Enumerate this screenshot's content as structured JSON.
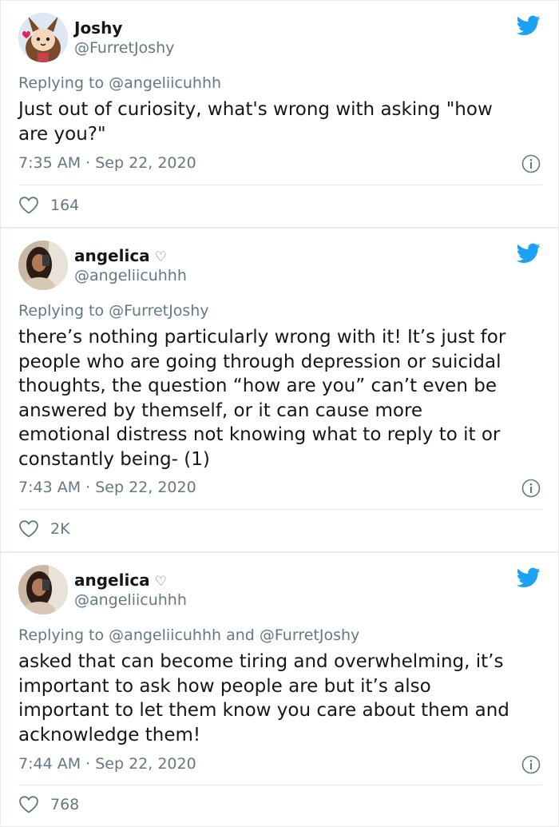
{
  "colors": {
    "brand_blue": "#1da1f2",
    "text": "#14171a",
    "secondary": "#657786",
    "border": "#e6ecf0"
  },
  "tweets": [
    {
      "name": "Joshy",
      "handle": "@FurretJoshy",
      "replying_prefix": "Replying to",
      "replying_to": [
        "@angeliicuhhh"
      ],
      "body_lines": [
        "Just out of curiosity, what's wrong with asking \"how",
        "are you?\""
      ],
      "timestamp": "7:35 AM · Sep 22, 2020",
      "likes": "164",
      "icons": {
        "brand": "twitter-bird-icon",
        "info": "info-icon",
        "like": "heart-icon"
      }
    },
    {
      "name": "angelica",
      "name_suffix": "♡",
      "handle": "@angeliicuhhh",
      "replying_prefix": "Replying to",
      "replying_to": [
        "@FurretJoshy"
      ],
      "body_lines": [
        "there’s nothing particularly wrong with it! It’s just for",
        "people who are going through depression or suicidal",
        "thoughts, the question “how are you” can’t even be",
        "answered by themself, or it can cause more",
        "emotional distress not knowing what to reply to it or",
        "constantly being- (1)"
      ],
      "timestamp": "7:43 AM · Sep 22, 2020",
      "likes": "2K"
    },
    {
      "name": "angelica",
      "name_suffix": "♡",
      "handle": "@angeliicuhhh",
      "replying_prefix": "Replying to",
      "replying_to": [
        "@angeliicuhhh",
        "@FurretJoshy"
      ],
      "replying_joiner": "and",
      "body_lines": [
        "asked that can become tiring and overwhelming, it’s",
        "important to ask how people are but it’s also",
        "important to let them know you care about them and",
        "acknowledge them!"
      ],
      "timestamp": "7:44 AM · Sep 22, 2020",
      "likes": "768"
    }
  ]
}
